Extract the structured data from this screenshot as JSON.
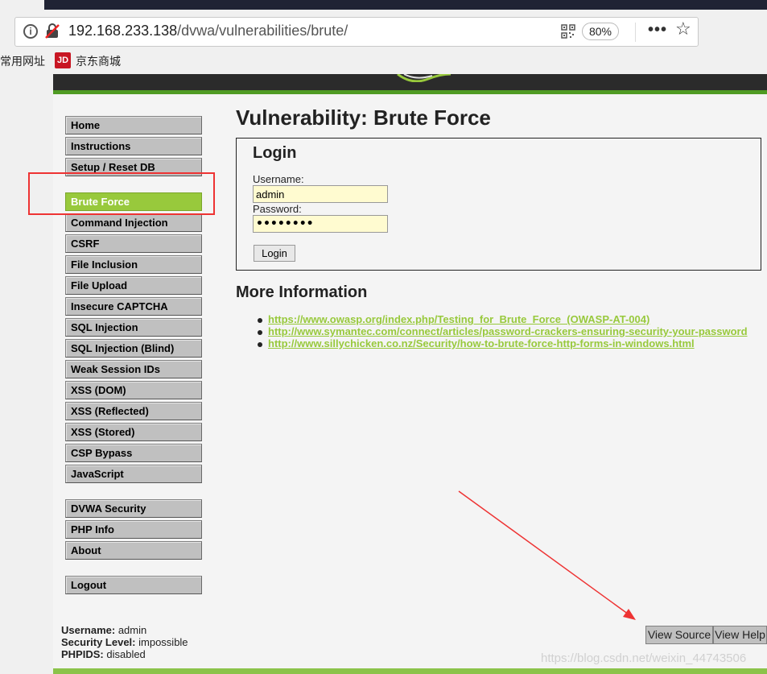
{
  "browser": {
    "url_host": "192.168.233.138",
    "url_path": "/dvwa/vulnerabilities/brute/",
    "zoom": "80%",
    "more_label": "•••",
    "bookmarks": [
      {
        "label": "常用网址"
      },
      {
        "label": "京东商城",
        "icon_text": "JD"
      }
    ]
  },
  "nav": {
    "group1": [
      "Home",
      "Instructions",
      "Setup / Reset DB"
    ],
    "group2": [
      "Brute Force",
      "Command Injection",
      "CSRF",
      "File Inclusion",
      "File Upload",
      "Insecure CAPTCHA",
      "SQL Injection",
      "SQL Injection (Blind)",
      "Weak Session IDs",
      "XSS (DOM)",
      "XSS (Reflected)",
      "XSS (Stored)",
      "CSP Bypass",
      "JavaScript"
    ],
    "group3": [
      "DVWA Security",
      "PHP Info",
      "About"
    ],
    "group4": [
      "Logout"
    ],
    "active": "Brute Force"
  },
  "main": {
    "title": "Vulnerability: Brute Force",
    "login": {
      "title": "Login",
      "username_label": "Username:",
      "username_value": "admin",
      "password_label": "Password:",
      "password_dots": "••••••••",
      "button": "Login"
    },
    "more_info_title": "More Information",
    "links": [
      "https://www.owasp.org/index.php/Testing_for_Brute_Force_(OWASP-AT-004)",
      "http://www.symantec.com/connect/articles/password-crackers-ensuring-security-your-password",
      "http://www.sillychicken.co.nz/Security/how-to-brute-force-http-forms-in-windows.html"
    ]
  },
  "status": {
    "username_label": "Username:",
    "username": "admin",
    "security_label": "Security Level:",
    "security": "impossible",
    "phpids_label": "PHPIDS:",
    "phpids": "disabled"
  },
  "footer": {
    "view_source": "View Source",
    "view_help": "View Help"
  },
  "watermark": "https://blog.csdn.net/weixin_44743506",
  "colors": {
    "accent_green": "#98c93c",
    "header_dark": "#2b2b2b",
    "annotation_red": "#e33333"
  }
}
